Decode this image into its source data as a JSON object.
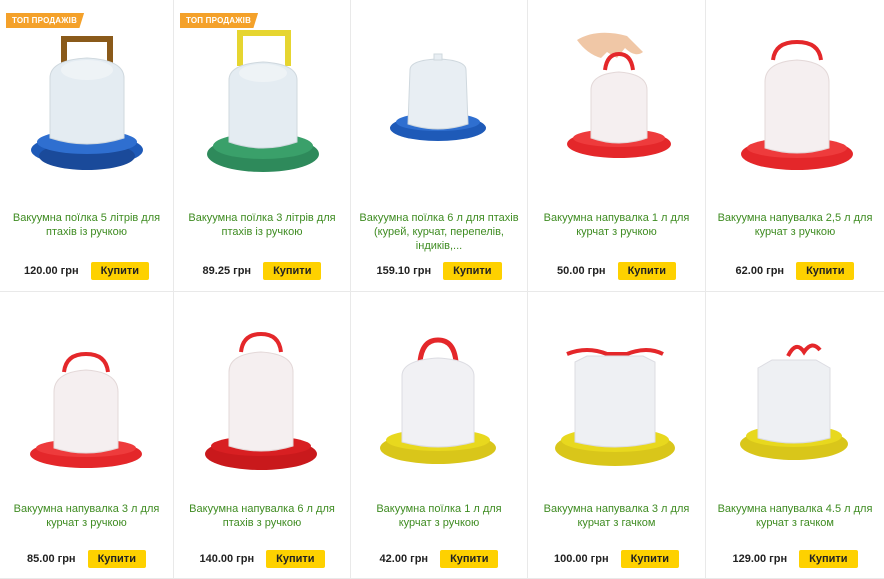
{
  "badge_label": "ТОП ПРОДАЖІВ",
  "colors": {
    "title": "#3f8c22",
    "button": "#fed100",
    "badge": "#f4a12a"
  },
  "products": [
    {
      "title": "Вакуумна поїлка 5 літрів для птахів із ручкою",
      "price": "120.00 грн",
      "button": "Купити",
      "badge": true,
      "base_color": "#1e5ab8",
      "handle_color": "#8a5a1a",
      "icon": "blue-feeder-with-brown-handle"
    },
    {
      "title": "Вакуумна поїлка 3 літрів для птахів із ручкою",
      "price": "89.25 грн",
      "button": "Купити",
      "badge": true,
      "base_color": "#2e8a5b",
      "handle_color": "#e6d530",
      "icon": "green-feeder-with-yellow-handle"
    },
    {
      "title": "Вакуумна поїлка 6 л для птахів (курей, курчат, перепелів, індиків,...",
      "price": "159.10 грн",
      "button": "Купити",
      "badge": false,
      "base_color": "#1e5ab8",
      "handle_color": "",
      "icon": "blue-feeder"
    },
    {
      "title": "Вакуумна напувалка 1 л для курчат з ручкою",
      "price": "50.00 грн",
      "button": "Купити",
      "badge": false,
      "base_color": "#e4272a",
      "handle_color": "#e4272a",
      "icon": "red-feeder-held-by-hand"
    },
    {
      "title": "Вакуумна напувалка 2,5 л для курчат з ручкою",
      "price": "62.00 грн",
      "button": "Купити",
      "badge": false,
      "base_color": "#e4272a",
      "handle_color": "#e4272a",
      "icon": "red-feeder-with-handle"
    },
    {
      "title": "Вакуумна напувалка 3 л для курчат з ручкою",
      "price": "85.00 грн",
      "button": "Купити",
      "badge": false,
      "base_color": "#e4272a",
      "handle_color": "#e4272a",
      "icon": "red-feeder-with-handle"
    },
    {
      "title": "Вакуумна напувалка 6 л для птахів з ручкою",
      "price": "140.00 грн",
      "button": "Купити",
      "badge": false,
      "base_color": "#d81f22",
      "handle_color": "#e4272a",
      "icon": "red-feeder-with-handle"
    },
    {
      "title": "Вакуумна поїлка 1 л для курчат з ручкою",
      "price": "42.00 грн",
      "button": "Купити",
      "badge": false,
      "base_color": "#e8d81e",
      "handle_color": "#e4272a",
      "icon": "yellow-feeder-with-red-handle"
    },
    {
      "title": "Вакуумна напувалка 3 л для курчат з гачком",
      "price": "100.00 грн",
      "button": "Купити",
      "badge": false,
      "base_color": "#e8d81e",
      "handle_color": "#e4272a",
      "icon": "yellow-feeder-with-hook"
    },
    {
      "title": "Вакуумна напувалка 4.5 л для курчат з гачком",
      "price": "129.00 грн",
      "button": "Купити",
      "badge": false,
      "base_color": "#e8d81e",
      "handle_color": "#e4272a",
      "icon": "yellow-feeder-with-hook"
    }
  ]
}
